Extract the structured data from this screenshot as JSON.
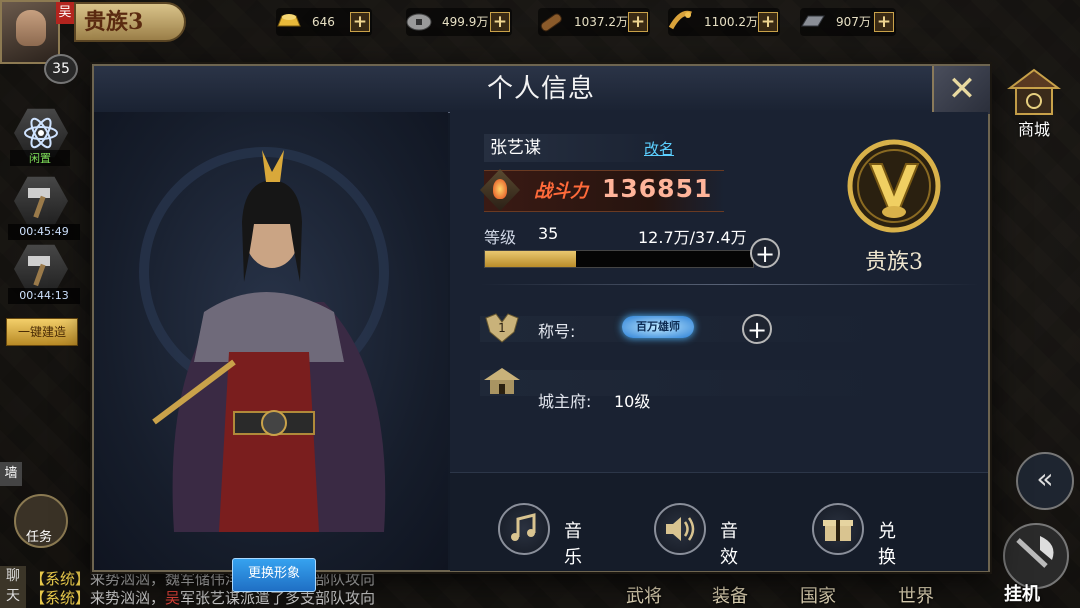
{
  "topbar": {
    "player_level": "35",
    "surname_tag": "吴",
    "noble_rank": "贵族3",
    "power_partial": "战力136851",
    "resources": [
      {
        "icon": "gold-ingot-icon",
        "value": "646"
      },
      {
        "icon": "copper-coin-icon",
        "value": "499.9万"
      },
      {
        "icon": "wood-log-icon",
        "value": "1037.2万"
      },
      {
        "icon": "grain-icon",
        "value": "1100.2万"
      },
      {
        "icon": "iron-bar-icon",
        "value": "907万"
      }
    ],
    "plus": "+"
  },
  "sidebar": {
    "idle_label": "闲置",
    "timer1": "00:45:49",
    "timer2": "00:44:13",
    "build_all": "一键建造",
    "task": "任务",
    "street_tag": "墙"
  },
  "right": {
    "shop": "商城",
    "collapse": "«",
    "hangup": "挂机"
  },
  "bottom": {
    "chat_tab": "聊天",
    "chat_lines": [
      {
        "sys": "【系统】",
        "text": "来势汹汹，魏军储伟洋派遣了多支部队攻向"
      },
      {
        "sys": "【系统】",
        "pre": "来势汹汹，",
        "faction": "吴",
        "text": "军张艺谋派遣了多支部队攻向"
      }
    ],
    "tabs": [
      "武将",
      "装备",
      "国家",
      "世界"
    ]
  },
  "dialog": {
    "title": "个人信息",
    "close": "✕",
    "change_look": "更换形象",
    "name": "张艺谋",
    "rename": "改名",
    "power_label": "战斗力",
    "power_value": "136851",
    "level_label": "等级",
    "level_value": "35",
    "exp_text": "12.7万/37.4万",
    "exp_progress": 0.34,
    "noble_label": "贵族3",
    "title_label": "称号:",
    "title_badge": "百万雄师",
    "city_label": "城主府:",
    "city_value": "10级",
    "actions": [
      {
        "label": "音乐",
        "icon": "music-note-icon"
      },
      {
        "label": "音效",
        "icon": "speaker-icon"
      },
      {
        "label": "兑换",
        "icon": "gift-box-icon"
      }
    ]
  },
  "colors": {
    "accent_gold": "#d9b24a",
    "power_red": "#ff6a3a",
    "rename_link": "#5cd0ff",
    "change_look_blue": "#2a86dc"
  }
}
